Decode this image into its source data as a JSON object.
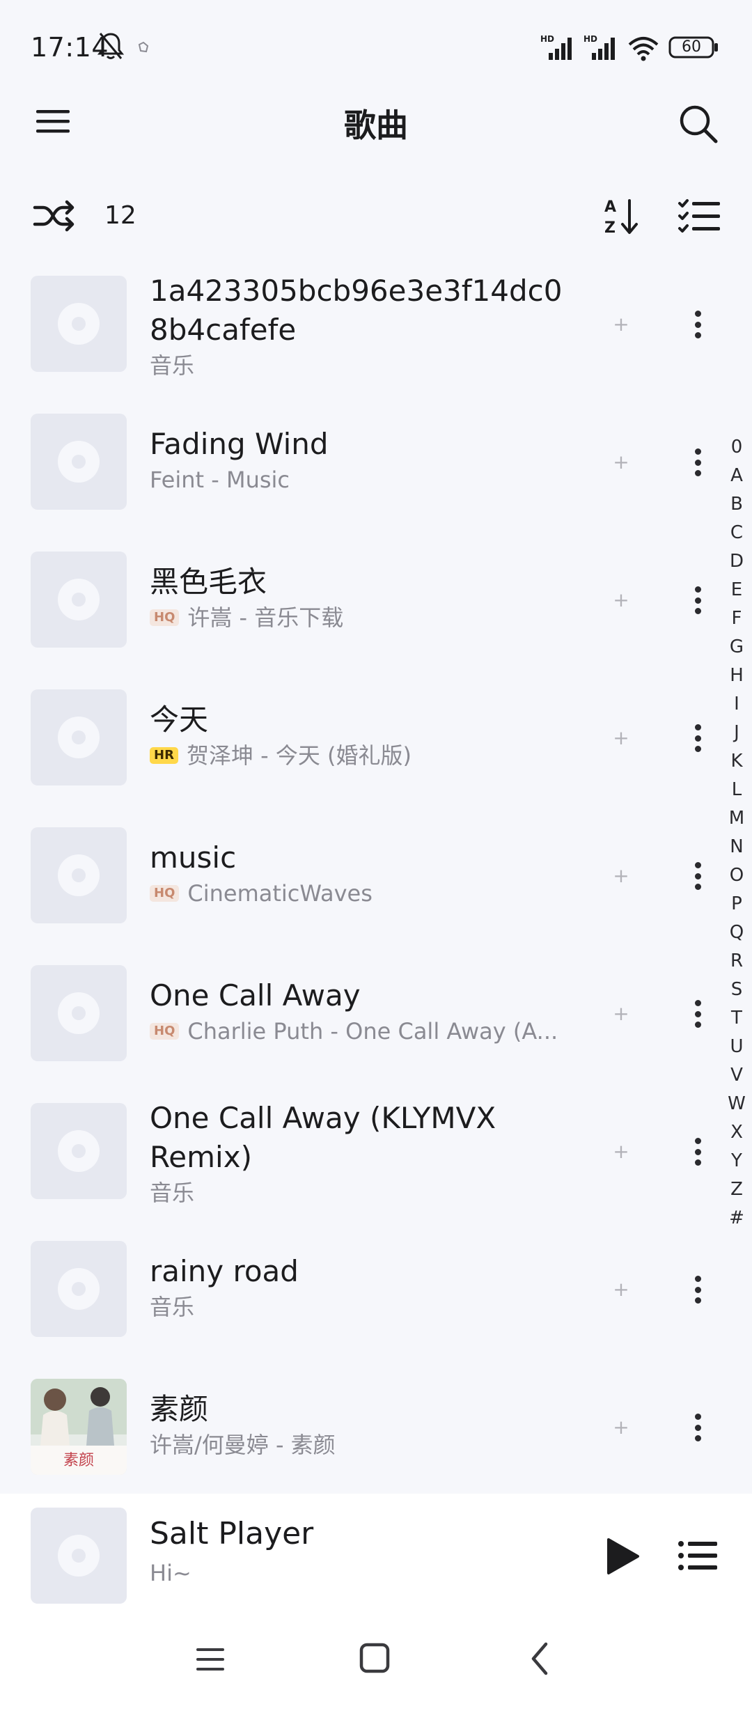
{
  "status_bar": {
    "time": "17:14",
    "battery": "60"
  },
  "header": {
    "title": "歌曲"
  },
  "toolbar": {
    "count": "12"
  },
  "songs": [
    {
      "title_line1": "1a423305bcb96e3e3f14dc0",
      "title_line2": "8b4cafefe",
      "subtitle": "音乐",
      "badge": ""
    },
    {
      "title_line1": "Fading Wind",
      "title_line2": "",
      "subtitle": "Feint - Music",
      "badge": ""
    },
    {
      "title_line1": "黑色毛衣",
      "title_line2": "",
      "subtitle": "许嵩 - 音乐下载",
      "badge": "HQ"
    },
    {
      "title_line1": "今天",
      "title_line2": "",
      "subtitle": "贺泽坤 - 今天 (婚礼版)",
      "badge": "HR"
    },
    {
      "title_line1": "music",
      "title_line2": "",
      "subtitle": "CinematicWaves",
      "badge": "HQ"
    },
    {
      "title_line1": "One Call Away",
      "title_line2": "",
      "subtitle": "Charlie Puth - One Call Away (A...",
      "badge": "HQ"
    },
    {
      "title_line1": "One Call Away (KLYMVX",
      "title_line2": "Remix)",
      "subtitle": "音乐",
      "badge": ""
    },
    {
      "title_line1": "rainy road",
      "title_line2": "",
      "subtitle": "音乐",
      "badge": ""
    },
    {
      "title_line1": "素颜",
      "title_line2": "",
      "subtitle": "许嵩/何曼婷 - 素颜",
      "badge": "",
      "cover_text": "素颜"
    }
  ],
  "alphabet": [
    "0",
    "A",
    "B",
    "C",
    "D",
    "E",
    "F",
    "G",
    "H",
    "I",
    "J",
    "K",
    "L",
    "M",
    "N",
    "O",
    "P",
    "Q",
    "R",
    "S",
    "T",
    "U",
    "V",
    "W",
    "X",
    "Y",
    "Z",
    "#"
  ],
  "player": {
    "title": "Salt Player",
    "subtitle": "Hi~"
  },
  "colors": {
    "background": "#f6f7fb",
    "placeholder_cover": "#e6e8f0",
    "hq_badge": "#f4e6df",
    "hr_badge": "#ffd84a",
    "secondary_text": "#8a8a92"
  }
}
